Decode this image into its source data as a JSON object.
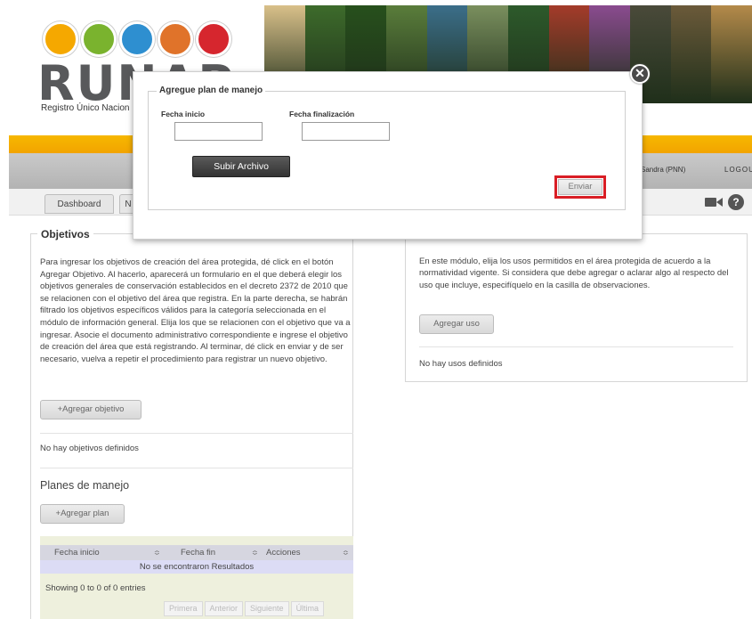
{
  "header": {
    "logo_text": "RUNAP",
    "logo_subtitle": "Registro Único Nacion",
    "logo_circle_colors": [
      "#f5a800",
      "#7ab32e",
      "#2e8fd0",
      "#e0732a",
      "#d6262e"
    ],
    "photo_colors": [
      "#d9c08a",
      "#3d6b2b",
      "#27501c",
      "#5a7d3b",
      "#3b6e8a",
      "#7a8f5e",
      "#2d5a2b",
      "#a43b2a",
      "#8a4b8f",
      "#4a4a3a",
      "#6b5a3a",
      "#b48a4a"
    ],
    "user_label": "Sandra (PNN)",
    "logout_label": "LOGOU",
    "tabs": [
      "Dashboard",
      "N"
    ]
  },
  "modal": {
    "title": "Agregue plan de manejo",
    "fecha_inicio_label": "Fecha inicio",
    "fecha_fin_label": "Fecha finalización",
    "fecha_inicio_value": "",
    "fecha_fin_value": "",
    "upload_label": "Subir Archivo",
    "submit_label": "Enviar",
    "close_icon": "✕"
  },
  "objetivos": {
    "title": "Objetivos",
    "description": "Para ingresar los objetivos de creación del área protegida, dé click en el botón Agregar Objetivo. Al hacerlo, aparecerá un formulario en el que deberá elegir los objetivos generales de conservación establecidos en el decreto 2372 de 2010 que se relacionen con el objetivo del área que registra. En la parte derecha, se habrán filtrado los objetivos específicos válidos para la categoría seleccionada en el módulo de información general. Elija los que se relacionen con el objetivo que va a ingresar. Asocie el documento administrativo correspondiente e ingrese el objetivo de creación del área que está registrando. Al terminar, dé click en enviar y de ser necesario, vuelva a repetir el procedimiento para registrar un nuevo objetivo.",
    "add_button": "+Agregar objetivo",
    "empty_text": "No hay objetivos definidos",
    "planes_title": "Planes de manejo",
    "add_plan_button": "+Agregar plan",
    "table": {
      "columns": [
        "Fecha inicio",
        "Fecha fin",
        "Acciones"
      ],
      "sort_icon": "≎",
      "empty_row": "No se encontraron Resultados",
      "info": "Showing 0 to 0 of 0 entries",
      "pager": [
        "Primera",
        "Anterior",
        "Siguiente",
        "Última"
      ]
    }
  },
  "usos": {
    "description": "En este módulo, elija los usos permitidos en el área protegida de acuerdo a la normatividad vigente. Si considera que debe agregar o aclarar algo al respecto del uso que incluye, especifíquelo en la casilla de observaciones.",
    "add_button": "Agregar uso",
    "empty_text": "No hay usos definidos"
  },
  "icons": {
    "help": "?"
  }
}
